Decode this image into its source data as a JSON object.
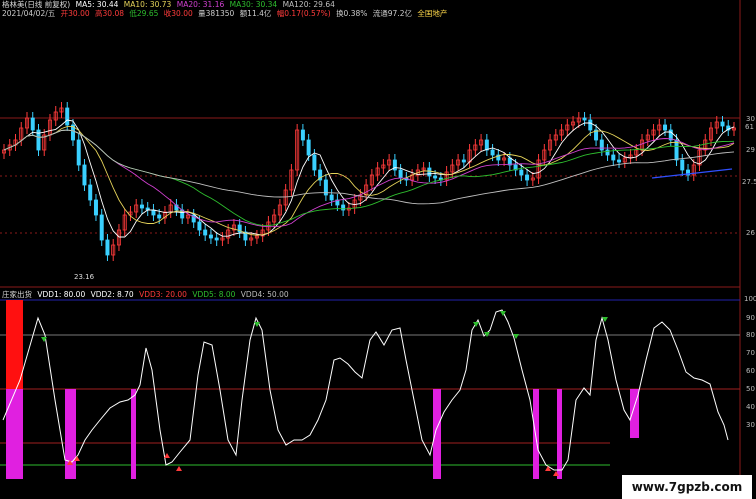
{
  "header": {
    "stock_name": "格林美(日线 前复权)",
    "ma5": "MA5: 30.44",
    "ma10": "MA10: 30.73",
    "ma20": "MA20: 31.16",
    "ma30": "MA30: 30.34",
    "ma120": "MA120: 29.64",
    "date": "2021/04/02/五",
    "open": "开30.00",
    "high": "高30.08",
    "low": "低29.65",
    "close": "收30.00",
    "volume": "量381350",
    "amount": "额11.4亿",
    "change": "幅0.17(0.57%)",
    "turnover": "换0.38%",
    "float": "流通97.2亿",
    "sector": "全国地产"
  },
  "price_panel": {
    "low_label": "23.16",
    "right_ticks": [
      "30",
      "61",
      "29",
      "27.5",
      "26"
    ]
  },
  "indicator_panel": {
    "title": "庄家出货",
    "legend": {
      "v1": "VDD1: 80.00",
      "v2": "VDD2: 8.70",
      "v3": "VDD3: 20.00",
      "v5": "VDD5: 8.00",
      "v4": "VDD4: 50.00"
    },
    "right_ticks": [
      "100",
      "90",
      "80",
      "70",
      "60",
      "50",
      "40",
      "30"
    ]
  },
  "watermark": "www.7gpzb.com",
  "colors": {
    "background": "#000000",
    "up": "#ff3b3b",
    "down": "#3ad0ff",
    "ma5": "#ffffff",
    "ma10": "#e5d35a",
    "ma20": "#d040d0",
    "ma30": "#2ebd2e",
    "ma120": "#bfbfbf",
    "magenta_bar": "#e020e0",
    "red_bar": "#ff1010"
  }
}
